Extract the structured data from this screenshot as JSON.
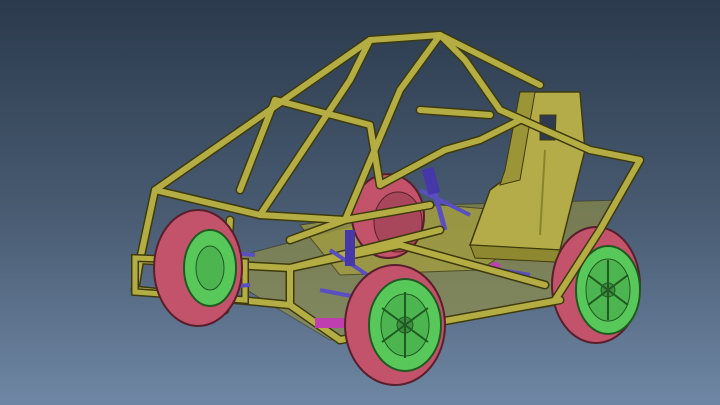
{
  "viewport": {
    "background_top": "#2b3a4c",
    "background_bottom": "#6f87a4"
  },
  "model": {
    "colors": {
      "frame_tube": "#b3ad43",
      "frame_edge": "#3e3a0e",
      "tire": "#c2536b",
      "tire_edge": "#5a1f2c",
      "rim": "#59c85a",
      "rim_edge": "#1f5a22",
      "seat": "#b4ac48",
      "suspension_arm": "#5a4fc0",
      "hub": "#c03fb0"
    },
    "components": [
      "tube-frame",
      "racing-seat",
      "front-left-wheel",
      "front-right-wheel",
      "rear-left-wheel",
      "rear-right-wheel",
      "front-suspension",
      "rear-suspension",
      "floor-pan"
    ]
  }
}
